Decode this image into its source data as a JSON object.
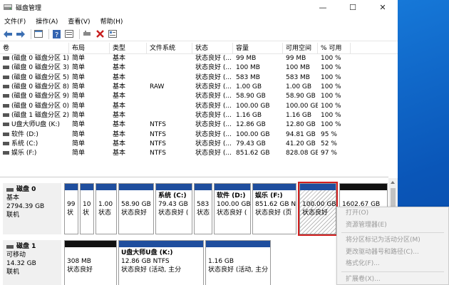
{
  "window": {
    "title": "磁盘管理",
    "minimize": "—",
    "maximize": "☐",
    "close": "✕"
  },
  "menu": [
    "文件(F)",
    "操作(A)",
    "查看(V)",
    "帮助(H)"
  ],
  "toolbar": {
    "icons": [
      "back-arrow-icon",
      "forward-arrow-icon",
      "console-icon",
      "help-icon",
      "properties-icon",
      "connect-icon",
      "delete-icon",
      "rescan-icon"
    ],
    "delete_color": "#c81e1e"
  },
  "table": {
    "columns": [
      "卷",
      "布局",
      "类型",
      "文件系统",
      "状态",
      "容量",
      "可用空间",
      "% 可用",
      ""
    ],
    "rows": [
      [
        "(磁盘 0 磁盘分区 1)",
        "简单",
        "基本",
        "",
        "状态良好 (...",
        "99 MB",
        "99 MB",
        "100 %"
      ],
      [
        "(磁盘 0 磁盘分区 3)",
        "简单",
        "基本",
        "",
        "状态良好 (...",
        "100 MB",
        "100 MB",
        "100 %"
      ],
      [
        "(磁盘 0 磁盘分区 5)",
        "简单",
        "基本",
        "",
        "状态良好 (...",
        "583 MB",
        "583 MB",
        "100 %"
      ],
      [
        "(磁盘 0 磁盘分区 8)",
        "简单",
        "基本",
        "RAW",
        "状态良好 (...",
        "1.00 GB",
        "1.00 GB",
        "100 %"
      ],
      [
        "(磁盘 0 磁盘分区 9)",
        "简单",
        "基本",
        "",
        "状态良好 (...",
        "58.90 GB",
        "58.90 GB",
        "100 %"
      ],
      [
        "(磁盘 0 磁盘分区 0)",
        "简单",
        "基本",
        "",
        "状态良好 (...",
        "100.00 GB",
        "100.00 GB",
        "100 %"
      ],
      [
        "(磁盘 1 磁盘分区 2)",
        "简单",
        "基本",
        "",
        "状态良好 (...",
        "1.16 GB",
        "1.16 GB",
        "100 %"
      ],
      [
        "U盘大师U盘 (K:)",
        "简单",
        "基本",
        "NTFS",
        "状态良好 (...",
        "12.86 GB",
        "12.80 GB",
        "100 %"
      ],
      [
        "软件 (D:)",
        "简单",
        "基本",
        "NTFS",
        "状态良好 (...",
        "100.00 GB",
        "94.81 GB",
        "95 %"
      ],
      [
        "系统 (C:)",
        "简单",
        "基本",
        "NTFS",
        "状态良好 (...",
        "79.43 GB",
        "41.20 GB",
        "52 %"
      ],
      [
        "娱乐 (F:)",
        "简单",
        "基本",
        "NTFS",
        "状态良好 (...",
        "851.62 GB",
        "828.08 GB",
        "97 %"
      ]
    ]
  },
  "disk0": {
    "name": "磁盘 0",
    "type": "基本",
    "size": "2794.39 GB",
    "status": "联机",
    "partitions": [
      {
        "name": "",
        "size": "99",
        "status": "状"
      },
      {
        "name": "",
        "size": "10",
        "status": "状"
      },
      {
        "name": "",
        "size": "1.00",
        "status": "状态"
      },
      {
        "name": "",
        "size": "58.90 GB",
        "status": "状态良好"
      },
      {
        "name": "系统 (C:)",
        "size": "79.43 GB",
        "status": "状态良好 ("
      },
      {
        "name": "",
        "size": "583",
        "status": "状态"
      },
      {
        "name": "软件 (D:)",
        "size": "100.00 GB",
        "status": "状态良好 ("
      },
      {
        "name": "娱乐 (F:)",
        "size": "851.62 GB N",
        "status": "状态良好 (页"
      },
      {
        "name": "",
        "size": "100.00 GB",
        "status": "状态良好"
      },
      {
        "name": "",
        "size": "1602.67 GB",
        "status": ""
      }
    ]
  },
  "disk1": {
    "name": "磁盘 1",
    "type": "可移动",
    "size": "14.32 GB",
    "status": "联机",
    "partitions": [
      {
        "name": "",
        "size": "308 MB",
        "status": "状态良好"
      },
      {
        "name": "U盘大师U盘 (K:)",
        "size": "12.86 GB NTFS",
        "status": "状态良好 (活动, 主分"
      },
      {
        "name": "",
        "size": "1.16 GB",
        "status": "状态良好 (活动, 主分"
      }
    ]
  },
  "context_menu": {
    "items": [
      "打开(O)",
      "资源管理器(E)",
      "将分区标记为活动分区(M)",
      "更改驱动器号和路径(C)...",
      "格式化(F)...",
      "扩展卷(X)..."
    ]
  }
}
